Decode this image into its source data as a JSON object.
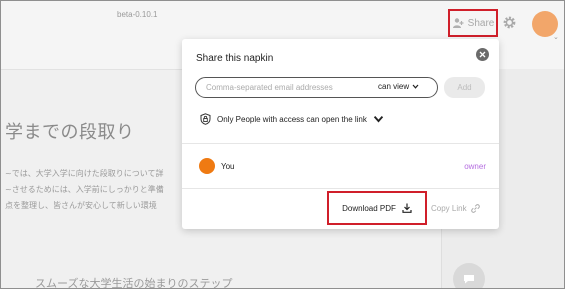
{
  "header": {
    "version": "beta-0.10.1",
    "share_label": "Share"
  },
  "document": {
    "title": "学までの段取り",
    "lines": [
      "~では、大学入学に向けた段取りについて詳",
      "~させるためには、入学前にしっかりと準備",
      "点を整理し、皆さんが安心して新しい環境"
    ],
    "subheading": "スムーズな大学生活の始まりのステップ"
  },
  "share_modal": {
    "title": "Share this napkin",
    "email_placeholder": "Comma-separated email addresses",
    "permission_value": "can view",
    "add_label": "Add",
    "access_label": "Only People with access can open the link",
    "user": {
      "name": "You",
      "role": "owner"
    },
    "download_label": "Download PDF",
    "copy_link_label": "Copy Link"
  },
  "colors": {
    "highlight_border": "#d01f2a",
    "avatar": "#f2a66a",
    "user_avatar": "#ef7a12",
    "owner_role": "#b56ee0"
  },
  "icons": [
    "share-person-icon",
    "gear-icon",
    "close-icon",
    "chevron-down-icon",
    "lock-shield-icon",
    "download-icon",
    "link-icon",
    "chat-icon"
  ]
}
